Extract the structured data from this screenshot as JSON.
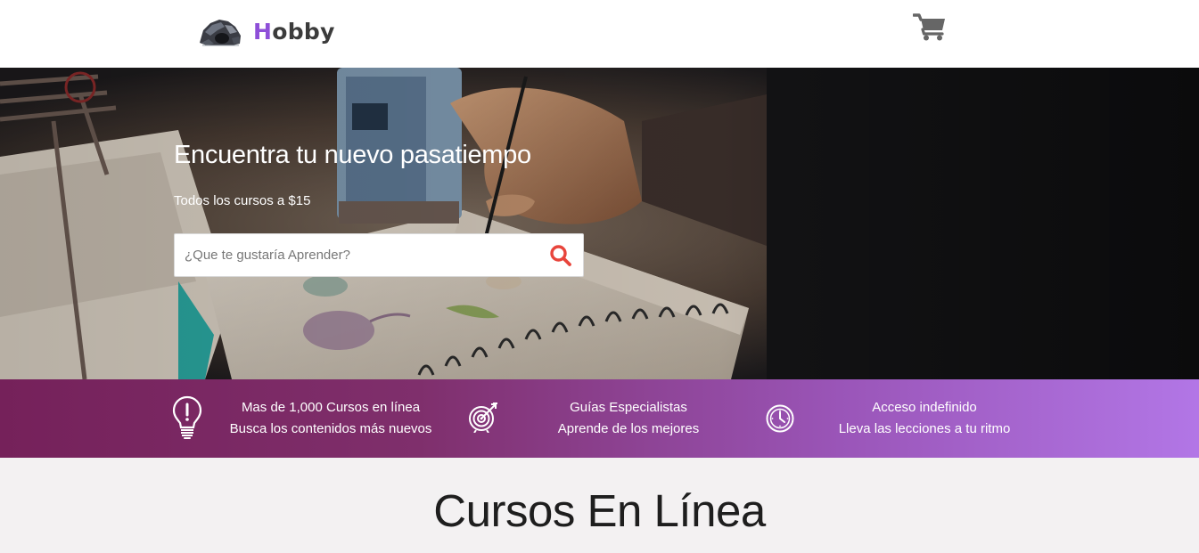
{
  "header": {
    "logo_first_letter": "H",
    "logo_rest": "obby",
    "logo_icon": "rock-logo",
    "cart_icon": "shopping-cart-icon"
  },
  "hero": {
    "title": "Encuentra tu nuevo pasatiempo",
    "subtitle": "Todos los cursos a $15",
    "search_placeholder": "¿Que te gustaría Aprender?",
    "search_icon": "search-icon"
  },
  "features": [
    {
      "icon": "lightbulb-icon",
      "line1": "Mas de 1,000 Cursos en línea",
      "line2": "Busca los contenidos más nuevos"
    },
    {
      "icon": "target-icon",
      "line1": "Guías Especialistas",
      "line2": "Aprende de los mejores"
    },
    {
      "icon": "clock-icon",
      "line1": "Acceso indefinido",
      "line2": "Lleva las lecciones a tu ritmo"
    }
  ],
  "section": {
    "title": "Cursos En Línea"
  },
  "colors": {
    "brand_purple": "#8e4fd8",
    "search_red": "#e8453c",
    "band_start": "#75215a",
    "band_end": "#b276e6"
  }
}
